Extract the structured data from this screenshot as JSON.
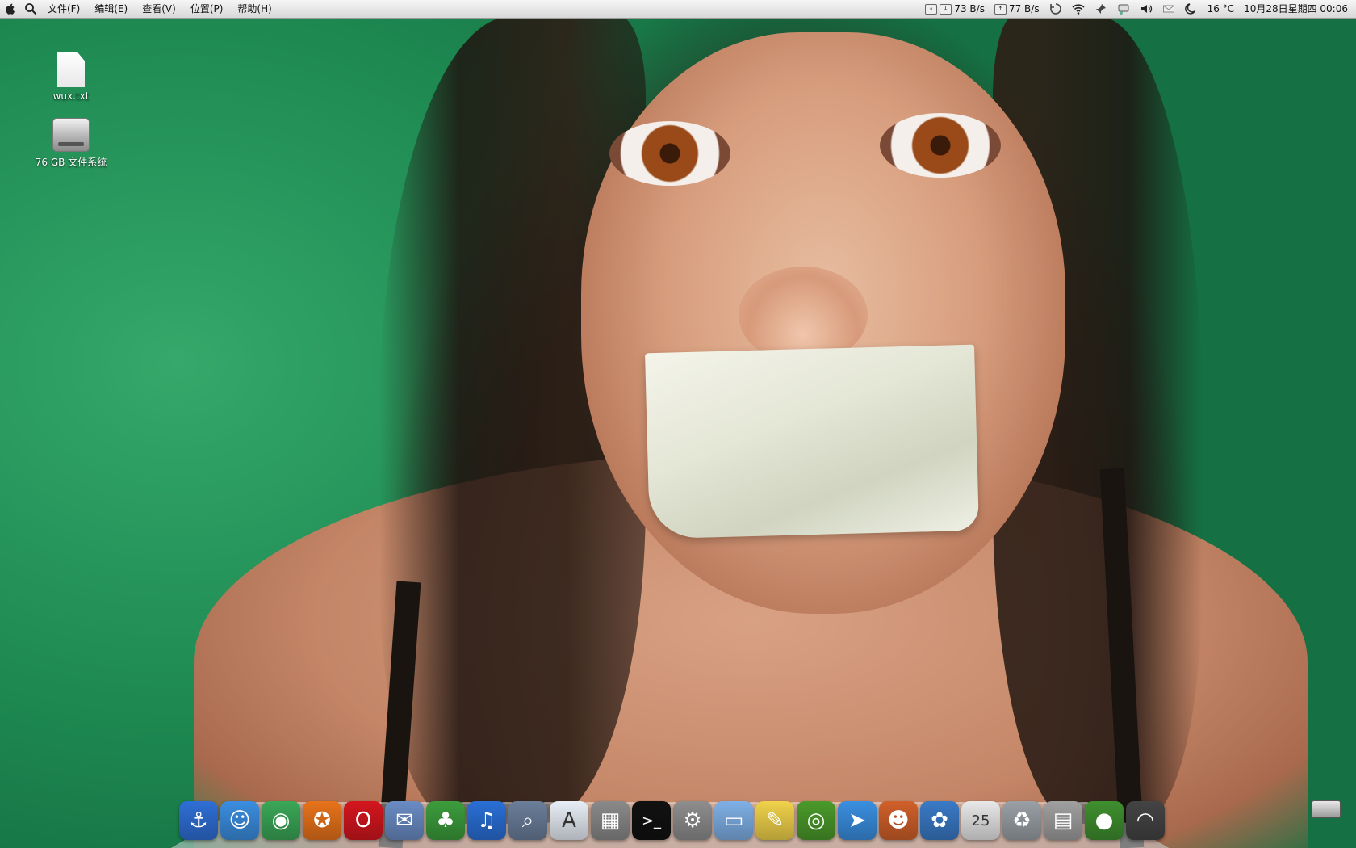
{
  "menubar": {
    "apple_icon": "apple-logo",
    "spotlight_icon": "search-icon",
    "menus": [
      "文件(F)",
      "编辑(E)",
      "查看(V)",
      "位置(P)",
      "帮助(H)"
    ],
    "status": {
      "net_down": "73 B/s",
      "net_up": "77 B/s",
      "temperature": "16 °C",
      "datetime": "10月28日星期四 00:06"
    }
  },
  "desktop": {
    "icons": [
      {
        "label": "wux.txt",
        "icon": "text-file-icon"
      },
      {
        "label": "76 GB 文件系统",
        "icon": "hard-drive-icon"
      }
    ]
  },
  "dock": {
    "items": [
      {
        "name": "anchor-app",
        "glyph": "⚓",
        "color": "#2f6fd6"
      },
      {
        "name": "finder",
        "glyph": "☺",
        "color": "#3b8ee0"
      },
      {
        "name": "chrome",
        "glyph": "◉",
        "color": "#3aa757"
      },
      {
        "name": "firefox",
        "glyph": "✪",
        "color": "#e8731b"
      },
      {
        "name": "opera",
        "glyph": "O",
        "color": "#d4161e"
      },
      {
        "name": "mail-stamp",
        "glyph": "✉",
        "color": "#6a8cc4"
      },
      {
        "name": "qq-penguin",
        "glyph": "♣",
        "color": "#3c9d3c"
      },
      {
        "name": "itunes",
        "glyph": "♫",
        "color": "#2a6fd6"
      },
      {
        "name": "preview",
        "glyph": "⌕",
        "color": "#6b7e9a"
      },
      {
        "name": "textedit",
        "glyph": "A",
        "color": "#e8eef6"
      },
      {
        "name": "calculator",
        "glyph": "▦",
        "color": "#8a8a8a"
      },
      {
        "name": "terminal",
        "glyph": ">_",
        "color": "#111111"
      },
      {
        "name": "system-preferences",
        "glyph": "⚙",
        "color": "#8e8e8e"
      },
      {
        "name": "folder",
        "glyph": "▭",
        "color": "#7fb0e6"
      },
      {
        "name": "stickies",
        "glyph": "✎",
        "color": "#f0d24a"
      },
      {
        "name": "ubuntu-app",
        "glyph": "◎",
        "color": "#4a9a2a"
      },
      {
        "name": "mail-app",
        "glyph": "➤",
        "color": "#3a8fe0"
      },
      {
        "name": "red-panda-app",
        "glyph": "☻",
        "color": "#d0602a"
      },
      {
        "name": "shiira-browser",
        "glyph": "✿",
        "color": "#3a7ac6"
      },
      {
        "name": "ical",
        "glyph": "25",
        "color": "#e8e8e8"
      },
      {
        "name": "trash",
        "glyph": "♻",
        "color": "#9aa0a6"
      },
      {
        "name": "drive-app",
        "glyph": "▤",
        "color": "#a0a0a0"
      },
      {
        "name": "green-orb",
        "glyph": "●",
        "color": "#3f8f2f"
      },
      {
        "name": "airport",
        "glyph": "◠",
        "color": "#444444"
      }
    ]
  }
}
